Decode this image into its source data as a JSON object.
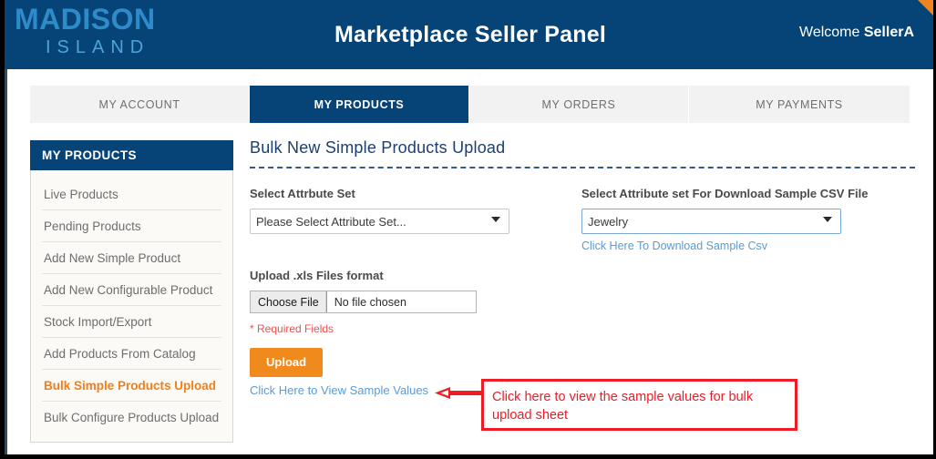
{
  "header": {
    "logo_main": "MADISON",
    "logo_sub": "ISLAND",
    "title": "Marketplace Seller Panel",
    "welcome_prefix": "Welcome",
    "welcome_user": "SellerA",
    "brand_blue": "#064377",
    "accent_orange": "#f08322"
  },
  "tabs": [
    {
      "label": "MY ACCOUNT",
      "active": false
    },
    {
      "label": "MY PRODUCTS",
      "active": true
    },
    {
      "label": "MY ORDERS",
      "active": false
    },
    {
      "label": "MY PAYMENTS",
      "active": false
    }
  ],
  "sidebar": {
    "heading": "MY PRODUCTS",
    "items": [
      {
        "label": "Live Products",
        "active": false
      },
      {
        "label": "Pending Products",
        "active": false
      },
      {
        "label": "Add New Simple Product",
        "active": false
      },
      {
        "label": "Add New Configurable Product",
        "active": false
      },
      {
        "label": "Stock Import/Export",
        "active": false
      },
      {
        "label": "Add Products From Catalog",
        "active": false
      },
      {
        "label": "Bulk Simple Products Upload",
        "active": true
      },
      {
        "label": "Bulk Configure Products Upload",
        "active": false
      }
    ],
    "active_color": "#ef7f1a"
  },
  "main": {
    "page_title": "Bulk New Simple Products Upload",
    "attribute_set": {
      "label": "Select Attrbute Set",
      "selected": "Please Select Attribute Set...",
      "options": [
        "Please Select Attribute Set..."
      ]
    },
    "download_set": {
      "label": "Select Attribute set For Download Sample CSV File",
      "selected": "Jewelry",
      "options": [
        "Jewelry"
      ],
      "link": "Click Here To Download Sample Csv"
    },
    "upload": {
      "label": "Upload .xls Files format",
      "choose_button": "Choose File",
      "file_name": "No file chosen",
      "required_note": "* Required Fields",
      "required_color": "#e8534f",
      "submit_label": "Upload",
      "submit_color": "#f08a1c"
    },
    "sample_values_link": "Click Here to View Sample Values"
  },
  "annotation": {
    "text": "Click here to view the sample values for bulk upload sheet",
    "color": "#ee1c25"
  }
}
